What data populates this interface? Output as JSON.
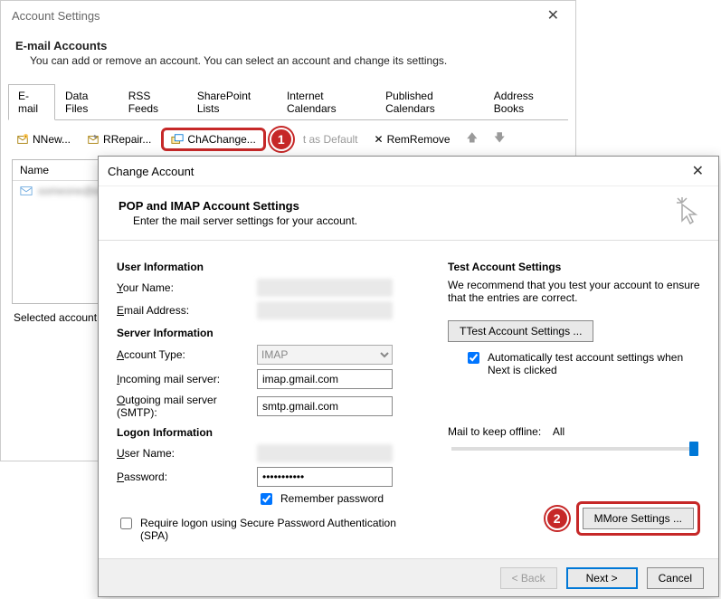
{
  "win1": {
    "title": "Account Settings",
    "head_title": "E-mail Accounts",
    "head_desc": "You can add or remove an account. You can select an account and change its settings.",
    "tabs": [
      "E-mail",
      "Data Files",
      "RSS Feeds",
      "SharePoint Lists",
      "Internet Calendars",
      "Published Calendars",
      "Address Books"
    ],
    "toolbar": {
      "new": "New...",
      "repair": "Repair...",
      "change": "Change...",
      "default": "t as Default",
      "remove": "Remove"
    },
    "list_header": "Name",
    "account_row": "someone@example.com",
    "selected_label": "Selected account de"
  },
  "step1": "1",
  "win2": {
    "title": "Change Account",
    "head_title": "POP and IMAP Account Settings",
    "head_desc": "Enter the mail server settings for your account.",
    "left": {
      "sect_user": "User Information",
      "lbl_name": "our Name:",
      "lbl_email": "mail Address:",
      "sect_server": "Server Information",
      "lbl_type": "ccount Type:",
      "type_value": "IMAP",
      "lbl_incoming": "ncoming mail server:",
      "incoming_value": "imap.gmail.com",
      "lbl_outgoing": "utgoing mail server (SMTP):",
      "outgoing_value": "smtp.gmail.com",
      "sect_logon": "Logon Information",
      "lbl_user": "ser Name:",
      "lbl_pass": "assword:",
      "pass_value": "***********",
      "remember": "emember password",
      "spa_line1": "uire logon using Secure Password Authentication",
      "spa_line2": "(SPA)"
    },
    "right": {
      "sect_test": "Test Account Settings",
      "test_desc": "We recommend that you test your account to ensure that the entries are correct.",
      "test_btn": "Test Account Settings ...",
      "auto_test": "Automatically test account settings when Next is clicked",
      "mail_keep_label": "Mail to keep offline:",
      "mail_keep_value": "All",
      "more_btn": "More Settings ..."
    },
    "footer": {
      "back": "< Back",
      "next": "Next >",
      "cancel": "Cancel"
    }
  },
  "step2": "2",
  "u": {
    "Y": "Y",
    "E": "E",
    "A": "A",
    "I": "I",
    "O": "O",
    "U": "U",
    "P": "P",
    "R": "R",
    "T": "T",
    "N": "N",
    "X": "X",
    "B": "B",
    "q": "q"
  }
}
